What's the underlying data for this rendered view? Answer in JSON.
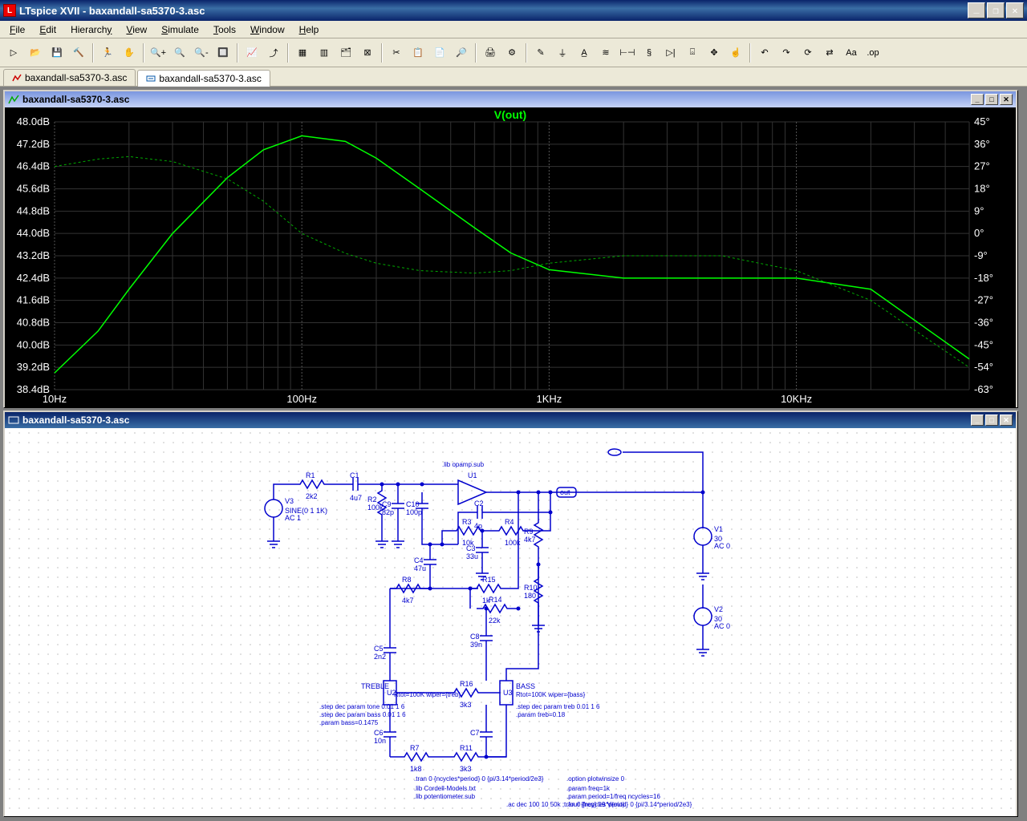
{
  "app": {
    "title": "LTspice XVII - baxandall-sa5370-3.asc"
  },
  "menu": [
    "File",
    "Edit",
    "Hierarchy",
    "View",
    "Simulate",
    "Tools",
    "Window",
    "Help"
  ],
  "toolbar_icons": [
    "run-icon",
    "open-icon",
    "save-icon",
    "hammer-icon",
    "|",
    "run-sim-icon",
    "pan-icon",
    "|",
    "zoom-in-icon",
    "zoom-fit-icon",
    "zoom-out-icon",
    "zoom-rect-icon",
    "|",
    "autorange-icon",
    "pick-icon",
    "|",
    "tile-h-icon",
    "tile-v-icon",
    "cascade-icon",
    "close-win-icon",
    "|",
    "cut-icon",
    "copy-icon",
    "paste-icon",
    "find-icon",
    "|",
    "print-icon",
    "print-setup-icon",
    "|",
    "draw-wire-icon",
    "ground-icon",
    "label-icon",
    "resistor-icon",
    "capacitor-icon",
    "inductor-icon",
    "diode-icon",
    "component-icon",
    "move-icon",
    "drag-icon",
    "|",
    "undo-icon",
    "redo-icon",
    "rotate-icon",
    "mirror-icon",
    "text-icon",
    "spice-dir-icon"
  ],
  "tabs": [
    {
      "label": "baxandall-sa5370-3.asc",
      "icon": "plot-tab-icon",
      "active": false
    },
    {
      "label": "baxandall-sa5370-3.asc",
      "icon": "schematic-tab-icon",
      "active": true
    }
  ],
  "plot_window": {
    "title": "baxandall-sa5370-3.asc",
    "trace_label": "V(out)"
  },
  "schematic_window": {
    "title": "baxandall-sa5370-3.asc"
  },
  "chart_data": {
    "type": "line",
    "title": "V(out)",
    "x_scale": "log",
    "x_ticks": [
      "10Hz",
      "100Hz",
      "1KHz",
      "10KHz"
    ],
    "y_left_label": "dB",
    "y_left_ticks": [
      "48.0dB",
      "47.2dB",
      "46.4dB",
      "45.6dB",
      "44.8dB",
      "44.0dB",
      "43.2dB",
      "42.4dB",
      "41.6dB",
      "40.8dB",
      "40.0dB",
      "39.2dB",
      "38.4dB"
    ],
    "y_left_range": [
      38.4,
      48.0
    ],
    "y_right_label": "deg",
    "y_right_ticks": [
      "45°",
      "36°",
      "27°",
      "18°",
      "9°",
      "0°",
      "-9°",
      "-18°",
      "-27°",
      "-36°",
      "-45°",
      "-54°",
      "-63°"
    ],
    "y_right_range": [
      -63,
      45
    ],
    "series": [
      {
        "name": "magnitude",
        "style": "solid",
        "x": [
          10,
          15,
          20,
          30,
          50,
          70,
          100,
          150,
          200,
          300,
          500,
          700,
          1000,
          2000,
          5000,
          10000,
          20000,
          50000
        ],
        "y_db": [
          39.0,
          40.5,
          42.0,
          44.0,
          46.0,
          47.0,
          47.5,
          47.3,
          46.7,
          45.6,
          44.2,
          43.3,
          42.7,
          42.4,
          42.4,
          42.4,
          42.0,
          39.5
        ]
      },
      {
        "name": "phase",
        "style": "dashed",
        "x": [
          10,
          15,
          20,
          30,
          50,
          70,
          100,
          150,
          200,
          300,
          500,
          700,
          1000,
          2000,
          5000,
          10000,
          20000,
          50000
        ],
        "y_deg": [
          27,
          30,
          31,
          29,
          22,
          13,
          0,
          -8,
          -12,
          -15,
          -16,
          -15,
          -12,
          -9,
          -9,
          -15,
          -27,
          -54
        ]
      }
    ]
  },
  "schematic": {
    "components": {
      "V3": {
        "label": "V3",
        "params": "SINE(0 1 1K)\nAC 1"
      },
      "R1": {
        "label": "R1",
        "value": "2k2"
      },
      "C1": {
        "label": "C1",
        "value": "4u7"
      },
      "R2": {
        "label": "R2",
        "value": "100k"
      },
      "C9": {
        "label": "C9",
        "value": "82p"
      },
      "C10": {
        "label": "C10",
        "value": "100p"
      },
      "U1": {
        "label": "U1"
      },
      "C2": {
        "label": "C2",
        "value": "4p"
      },
      "R3": {
        "label": "R3",
        "value": "10k"
      },
      "R4": {
        "label": "R4",
        "value": "100k"
      },
      "C3": {
        "label": "C3",
        "value": "33u"
      },
      "C4": {
        "label": "C4",
        "value": "47u"
      },
      "R9": {
        "label": "R9",
        "value": "4k7"
      },
      "R10": {
        "label": "R10",
        "value": "180"
      },
      "R8": {
        "label": "R8",
        "value": "4k7"
      },
      "R15": {
        "label": "R15",
        "value": "1k"
      },
      "R14": {
        "label": "R14",
        "value": "22k"
      },
      "C8": {
        "label": "C8",
        "value": "39n"
      },
      "C5": {
        "label": "C5",
        "value": "2n2"
      },
      "U2": {
        "label": "U2",
        "note": "TREBLE",
        "param": "Rtot=100K wiper={treb}"
      },
      "U3": {
        "label": "U3",
        "note": "BASS",
        "param": "Rtot=100K wiper={bass}"
      },
      "R16": {
        "label": "R16",
        "value": "3k3"
      },
      "C6": {
        "label": "C6",
        "value": "10n"
      },
      "C7": {
        "label": "C7"
      },
      "R7": {
        "label": "R7",
        "value": "1k8"
      },
      "R11": {
        "label": "R11",
        "value": "3k3"
      },
      "V1": {
        "label": "V1",
        "params": "30\nAC 0"
      },
      "V2": {
        "label": "V2",
        "params": "30\nAC 0"
      },
      "out": {
        "label": "out"
      }
    },
    "directives": [
      ".lib opamp.sub",
      ".step dec param tone 0.01 1 6",
      ".step dec param bass 0.01 1 6",
      ".param bass=0.1475",
      ".step dec param treb 0.01 1 6",
      ".param treb=0.18",
      ".tran 0 {ncycles*period} 0 {pi/3.14*period/2e3}",
      ".option plotwinsize 0",
      ".lib Cordell-Models.txt",
      ".lib potentiometer.sub",
      ".param freq=1k",
      ".param period=1/freq ncycles=16",
      ".ac dec 100 10 50k ;tran 0 {ncycles*period} 0 {pi/3.14*period/2e3}",
      ".four {freq} 19 V(out)"
    ]
  }
}
